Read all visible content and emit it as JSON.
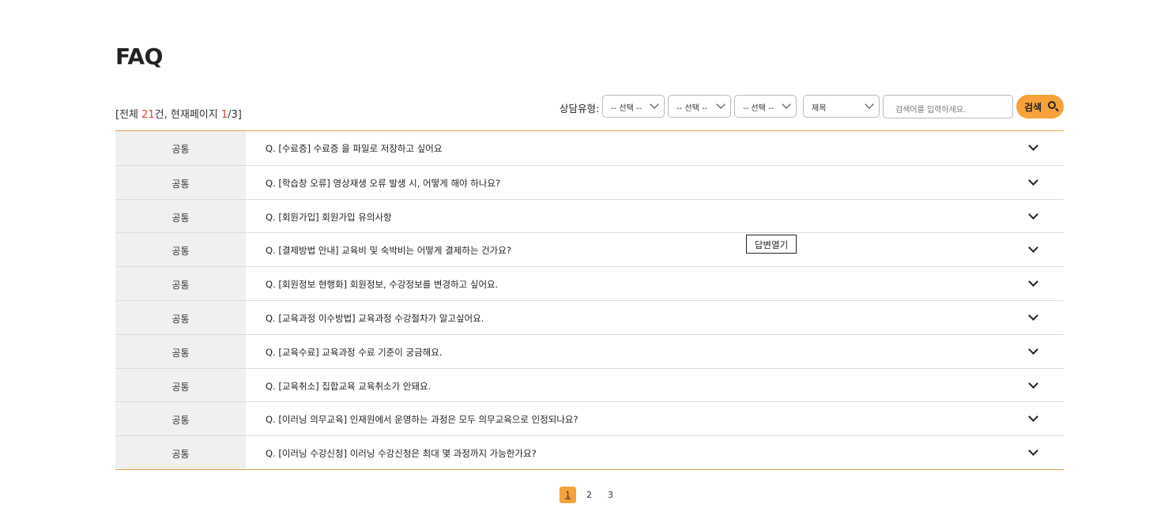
{
  "page_title": "FAQ",
  "summary": {
    "prefix": "[전체 ",
    "total": "21",
    "mid": "건, 현재페이지 ",
    "current": "1",
    "suffix": "/3]"
  },
  "search": {
    "label": "상담유형:",
    "select1": "-- 선택 --",
    "select2": "-- 선택 --",
    "select3": "-- 선택 --",
    "field": "제목",
    "placeholder": "검색어를 입력하세요.",
    "button": "검색"
  },
  "faq_items": [
    {
      "category": "공통",
      "question": "Q. [수료증] 수료증 을 파일로 저장하고 싶어요"
    },
    {
      "category": "공통",
      "question": "Q. [학습창 오류] 영상재생 오류 발생 시, 어떻게 해야 하나요?"
    },
    {
      "category": "공통",
      "question": "Q. [회원가입] 회원가입 유의사항"
    },
    {
      "category": "공통",
      "question": "Q. [결제방법 안내] 교육비 및 숙박비는 어떻게 결제하는 건가요?"
    },
    {
      "category": "공통",
      "question": "Q. [회원정보 현행화] 회원정보, 수강정보를 변경하고 싶어요."
    },
    {
      "category": "공통",
      "question": "Q. [교육과정 이수방법] 교육과정 수강절차가 알고싶어요."
    },
    {
      "category": "공통",
      "question": "Q. [교육수료] 교육과정 수료 기준이 궁금해요."
    },
    {
      "category": "공통",
      "question": "Q. [교육취소] 집합교육 교육취소가 안돼요."
    },
    {
      "category": "공통",
      "question": "Q. [이러닝 의무교육] 인재원에서 운영하는 과정은 모두 의무교육으로 인정되나요?"
    },
    {
      "category": "공통",
      "question": "Q. [이러닝 수강신청] 이러닝 수강신청은 최대 몇 과정까지 가능한가요?"
    }
  ],
  "tooltip": "답변열기",
  "pagination": [
    "1",
    "2",
    "3"
  ],
  "colors": {
    "accent": "#f7a13a",
    "count_red": "#e8412f",
    "border": "#e0a24a"
  }
}
